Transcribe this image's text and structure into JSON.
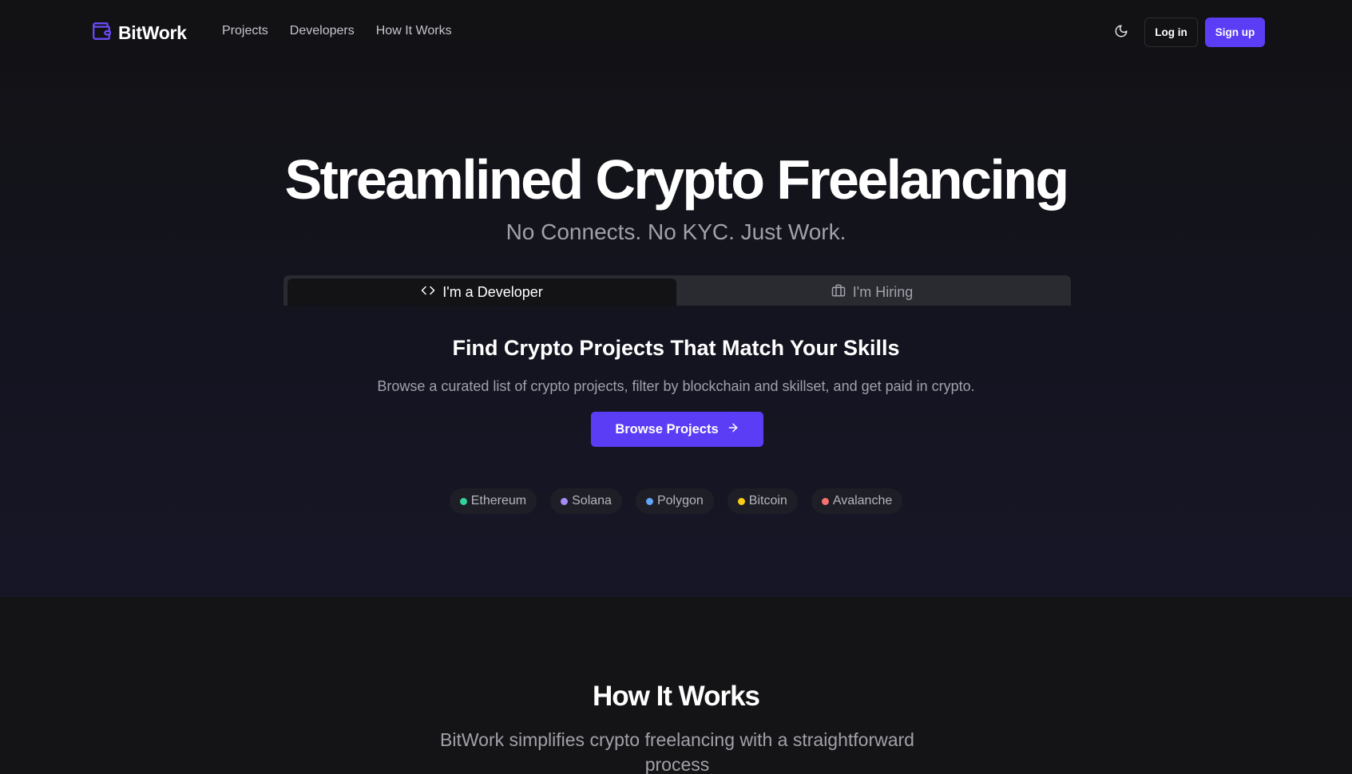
{
  "nav": {
    "brand": "BitWork",
    "links": [
      "Projects",
      "Developers",
      "How It Works"
    ],
    "login_label": "Log in",
    "signup_label": "Sign up"
  },
  "hero": {
    "title": "Streamlined Crypto Freelancing",
    "subtitle": "No Connects. No KYC. Just Work."
  },
  "tabs": {
    "items": [
      {
        "label": "I'm a Developer",
        "active": true,
        "icon": "code-icon"
      },
      {
        "label": "I'm Hiring",
        "active": false,
        "icon": "briefcase-icon"
      }
    ]
  },
  "developer_panel": {
    "title": "Find Crypto Projects That Match Your Skills",
    "description": "Browse a curated list of crypto projects, filter by blockchain and skillset, and get paid in crypto.",
    "cta_label": "Browse Projects"
  },
  "chains": [
    {
      "name": "Ethereum",
      "color": "#34d399"
    },
    {
      "name": "Solana",
      "color": "#a78bfa"
    },
    {
      "name": "Polygon",
      "color": "#60a5fa"
    },
    {
      "name": "Bitcoin",
      "color": "#facc15"
    },
    {
      "name": "Avalanche",
      "color": "#f87171"
    }
  ],
  "how_it_works": {
    "title": "How It Works",
    "description": "BitWork simplifies crypto freelancing with a straightforward process"
  },
  "colors": {
    "accent": "#5b3df5",
    "background": "#121214"
  }
}
